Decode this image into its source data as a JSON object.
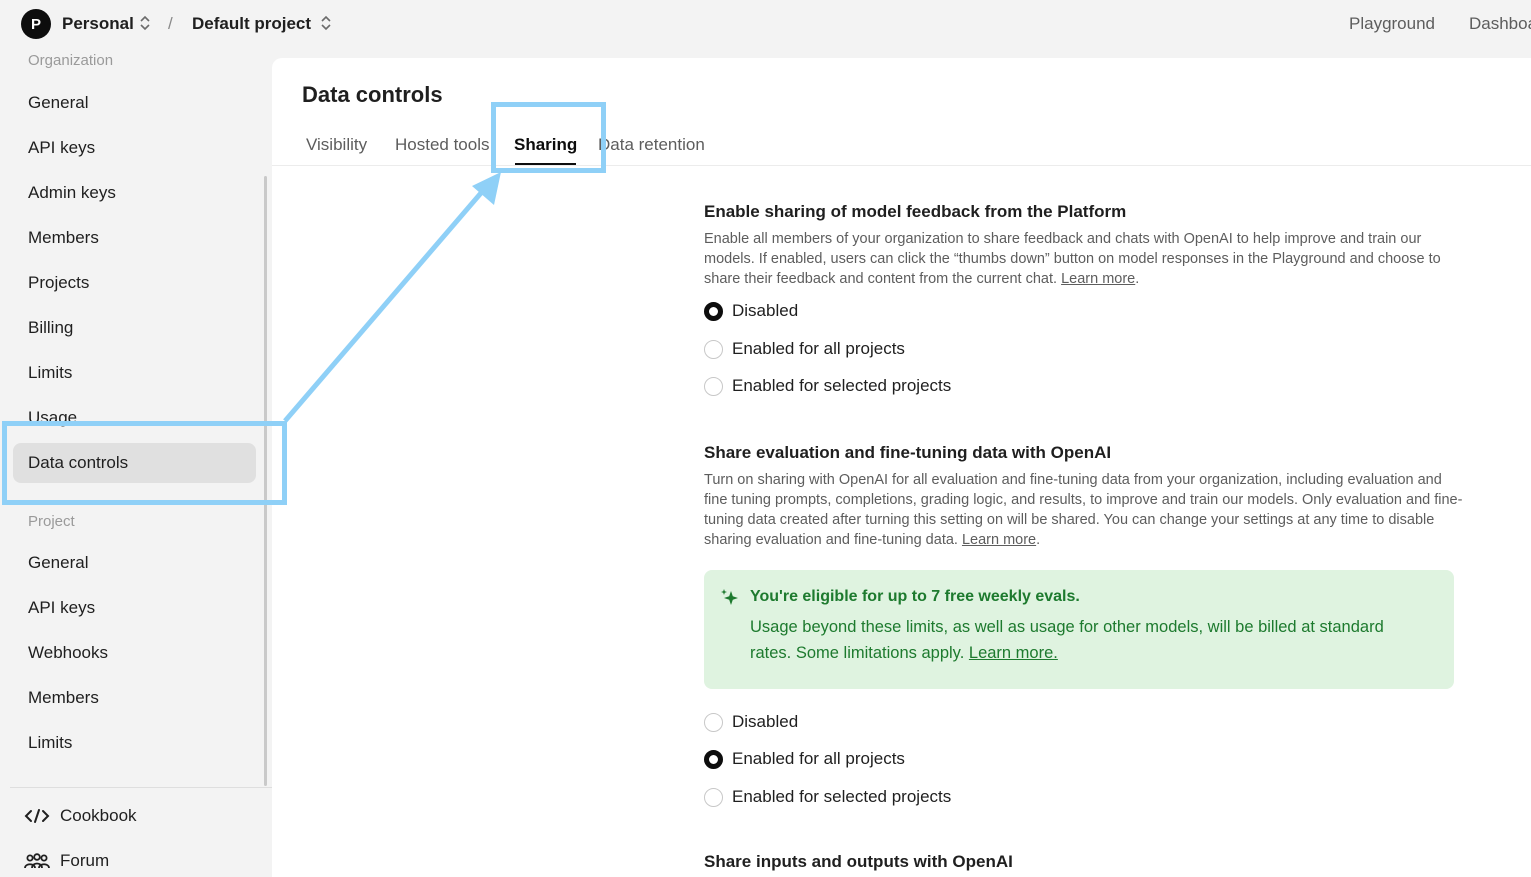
{
  "topbar": {
    "avatar_letter": "P",
    "org": "Personal",
    "separator": "/",
    "project": "Default project",
    "links": [
      "Playground",
      "Dashboa"
    ]
  },
  "sidebar": {
    "org_section_label": "Organization",
    "org_items": [
      "General",
      "API keys",
      "Admin keys",
      "Members",
      "Projects",
      "Billing",
      "Limits",
      "Usage",
      "Data controls"
    ],
    "active_item": "Data controls",
    "project_section_label": "Project",
    "project_items": [
      "General",
      "API keys",
      "Webhooks",
      "Members",
      "Limits"
    ],
    "footer": [
      {
        "label": "Cookbook",
        "icon": "code-icon"
      },
      {
        "label": "Forum",
        "icon": "people-icon"
      }
    ]
  },
  "main": {
    "title": "Data controls",
    "tabs": [
      "Visibility",
      "Hosted tools",
      "Sharing",
      "Data retention"
    ],
    "active_tab": "Sharing",
    "feedback_section": {
      "title": "Enable sharing of model feedback from the Platform",
      "description": "Enable all members of your organization to share feedback and chats with OpenAI to help improve and train our models. If enabled, users can click the “thumbs down” button on model responses in the Playground and choose to share their feedback and content from the current chat.",
      "learn_more": "Learn more",
      "options": [
        "Disabled",
        "Enabled for all projects",
        "Enabled for selected projects"
      ],
      "selected": "Disabled"
    },
    "eval_section": {
      "title": "Share evaluation and fine-tuning data with OpenAI",
      "description": "Turn on sharing with OpenAI for all evaluation and fine-tuning data from your organization, including evaluation and fine tuning prompts, completions, grading logic, and results, to improve and train our models. Only evaluation and fine-tuning data created after turning this setting on will be shared. You can change your settings at any time to disable sharing evaluation and fine-tuning data.",
      "learn_more": "Learn more",
      "callout": {
        "icon": "sparkle-icon",
        "headline": "You're eligible for up to 7 free weekly evals.",
        "body": "Usage beyond these limits, as well as usage for other models, will be billed at standard rates. Some limitations apply.",
        "link": "Learn more."
      },
      "options": [
        "Disabled",
        "Enabled for all projects",
        "Enabled for selected projects"
      ],
      "selected": "Enabled for all projects"
    },
    "io_section": {
      "title": "Share inputs and outputs with OpenAI"
    }
  },
  "colors": {
    "highlight": "#8fd0f7",
    "callout_bg": "#dff3e0",
    "callout_text": "#1d7a2e"
  }
}
